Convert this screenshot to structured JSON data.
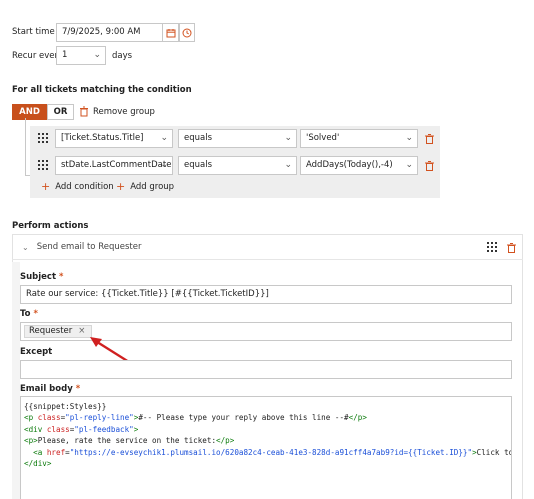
{
  "schedule": {
    "start_time_label": "Start time",
    "start_time_value": "7/9/2025, 9:00 AM",
    "recur_label": "Recur every",
    "recur_value": "1",
    "recur_unit": "days"
  },
  "conditions": {
    "heading": "For all tickets matching the condition",
    "and_label": "AND",
    "or_label": "OR",
    "remove_group_label": "Remove group",
    "rows": [
      {
        "field": "[Ticket.Status.Title]",
        "operator": "equals",
        "value": "'Solved'"
      },
      {
        "field": "stDate.LastCommentDate]",
        "operator": "equals",
        "value": "AddDays(Today(),-4)"
      }
    ],
    "add_condition_label": "Add condition",
    "add_group_label": "Add group"
  },
  "actions": {
    "heading": "Perform actions",
    "action_title": "Send email to Requester",
    "subject_label": "Subject",
    "subject_value": "Rate our service: {{Ticket.Title}} [#{{Ticket.TicketID}}]",
    "to_label": "To",
    "to_chip": "Requester",
    "except_label": "Except",
    "body_label": "Email body",
    "required_mark": "*",
    "body_lines": {
      "l1": "{{snippet:Styles}}",
      "l2_tag_open": "<p ",
      "l2_attr": "class",
      "l2_eq": "=",
      "l2_str": "\"pl-reply-line\"",
      "l2_rest_tag": ">",
      "l2_text": "#-- Please type your reply above this line --#",
      "l2_close": "</p>",
      "l3_tag_open": "<div ",
      "l3_attr": "class",
      "l3_eq": "=",
      "l3_str": "\"pl-feedback\"",
      "l3_close": ">",
      "l4_tag": "<p>",
      "l4_text": "Please, rate the service on the ticket:",
      "l4_close": "</p>",
      "l5_tag_open": "  <a ",
      "l5_attr": "href",
      "l5_eq": "=",
      "l5_str": "\"https://e-evseychik1.plumsail.io/620a82c4-ceab-41e3-828d-a91cff4a7ab9?id={{Ticket.ID}}\"",
      "l5_tag_end": ">",
      "l5_text": "Click to ra",
      "l6": "</div>"
    }
  },
  "colors": {
    "accent": "#c8501c",
    "arrow": "#d02020"
  }
}
